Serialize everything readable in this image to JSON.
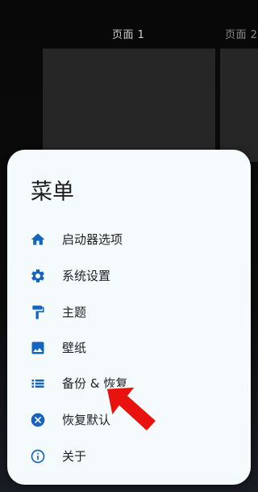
{
  "pages": [
    {
      "label": "页面 1"
    },
    {
      "label": "页面 2"
    }
  ],
  "menu": {
    "title": "菜单",
    "items": [
      {
        "label": "启动器选项",
        "icon": "home-icon"
      },
      {
        "label": "系统设置",
        "icon": "gear-icon"
      },
      {
        "label": "主题",
        "icon": "paint-roller-icon"
      },
      {
        "label": "壁纸",
        "icon": "image-icon"
      },
      {
        "label": "备份 & 恢复",
        "icon": "list-icon"
      },
      {
        "label": "恢复默认",
        "icon": "close-circle-icon"
      },
      {
        "label": "关于",
        "icon": "info-icon"
      }
    ]
  },
  "colors": {
    "accent": "#1565c0",
    "sheet_background": "#f5fbfc",
    "annotation_arrow": "#e8130f"
  }
}
